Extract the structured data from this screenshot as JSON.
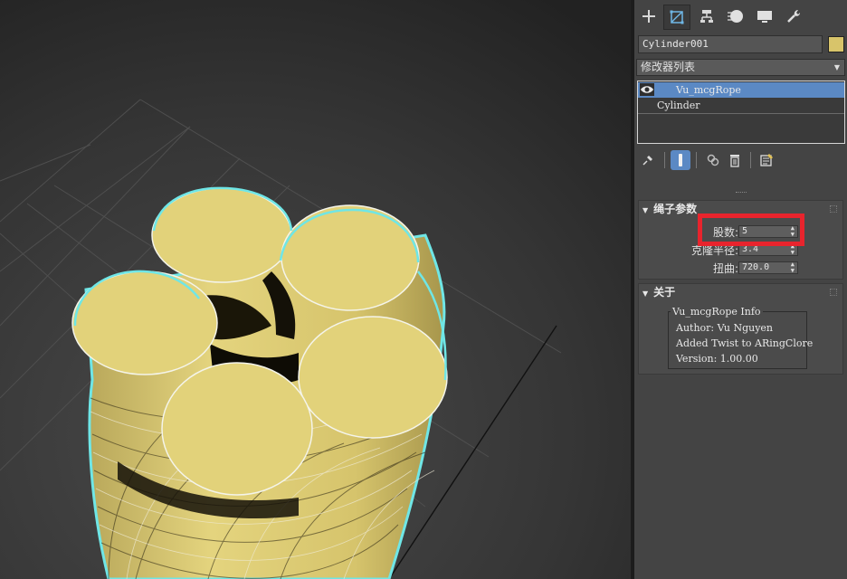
{
  "viewport": {
    "object_color": "#e2d27a",
    "selection_outline_color": "#6fe6e6"
  },
  "panel": {
    "tabs": [
      "create-icon",
      "modify-icon",
      "hierarchy-icon",
      "motion-icon",
      "display-icon",
      "utilities-icon"
    ],
    "active_tab": "modify-icon",
    "object_name": "Cylinder001",
    "object_color": "#d8c46a",
    "modifier_list_label": "修改器列表",
    "stack": [
      {
        "label": "Vu_mcgRope",
        "selected": true
      },
      {
        "label": "Cylinder",
        "selected": false
      }
    ],
    "rope_params": {
      "title": "绳子参数",
      "strands_label": "股数:",
      "strands_value": "5",
      "radius_label": "克隆半径:",
      "radius_value": "3.4",
      "twist_label": "扭曲:",
      "twist_value": "720.0"
    },
    "about": {
      "title": "关于",
      "info_title": "Vu_mcgRope Info",
      "author": "Author: Vu Nguyen",
      "added": "Added Twist to ARingClore",
      "version": "Version: 1.00.00"
    },
    "highlight_color": "#e8242d"
  }
}
